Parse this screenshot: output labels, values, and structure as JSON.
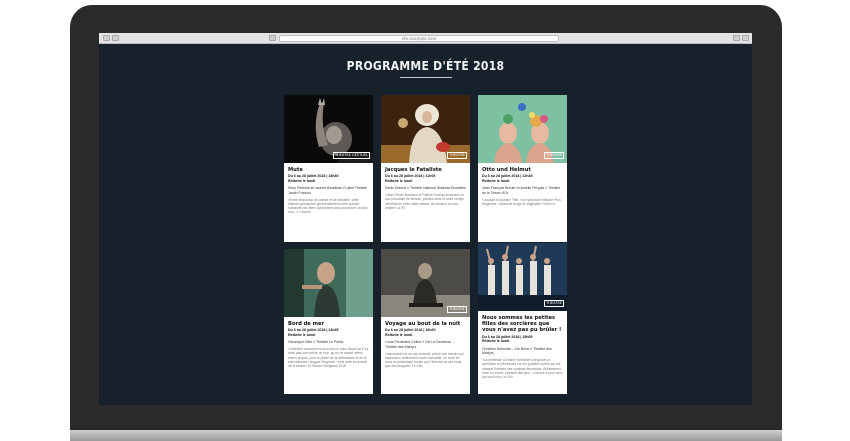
{
  "browser": {
    "url": "ete.example.com"
  },
  "page": {
    "title": "PROGRAMME D'ÉTÉ 2018"
  },
  "cards": [
    {
      "title": "Mute",
      "date": "Du 6 au 28 juillet 2018 | 18h40",
      "relache": "Relâche le lundi",
      "credits": "Sony Perlesia et Laurent Baudilias // Label Théâtre Jardin Fossion",
      "description": "«Entre beaucoup de poésie et de fantaisie, cette histoire questionne généreusement notre grande humanité des êtres qui tentent sans prononcer un seul mot...» L'Avenir",
      "tag": "THÉÂTRE GESTUEL"
    },
    {
      "title": "Jacques le Fataliste",
      "date": "Du 6 au 28 juillet 2018 | 11h05",
      "relache": "Relâche le lundi",
      "credits": "Denis Diderot // Théâtre National Wallonie-Bruxelles",
      "description": "«Jean-Pierre Baudson et Patrick Donnay incarnent un duo percutant de finesse, jubilant dans la toute vertige ventriste de cette fable mêlant, de dérision et avec amitié» La RT",
      "tag": "THÉÂTRE"
    },
    {
      "title": "Otto und Helmut",
      "date": "Du 6 au 28 juillet 2018 | 12h45",
      "relache": "Relâche le lundi",
      "credits": "Jean-François Breuer et Aurélie Pergola // Théâtre de la Toison d'Or",
      "description": "«Jouissif à souhait» Télé, «Un spectacle brillant» Plus Magazine, «Absurde burge et originalité» Vivre Ici",
      "tag": "THÉÂTRE"
    },
    {
      "title": "Bord de mer",
      "date": "Du 6 au 28 juillet 2018 | 14h45",
      "relache": "Relâche le lundi",
      "credits": "Véronique Olmi // Théâtre Le Public",
      "description": "«Vraiment comment nous sortis en nous disant qu'il n'y avait pas une mérite de trop, qu'on ne savait même mieux propos, pour le plaisir de la délicatesse et de la bienveillance» Nagyot Prugnauf, «Une tarte excentrée de la beaux» Si Sauvez Bergasse 2018",
      "tag": ""
    },
    {
      "title": "Voyage au bout de la nuit",
      "date": "Du 6 au 28 juillet 2018 | 16h20",
      "relache": "Relâche le lundi",
      "credits": "Louis-Ferdinand Céline // Cie La Semeuse – Théâtre des Martyrs",
      "description": "«Impossible de ne pas ressortir séduit une histoire qui impression amèrement toute l'actualité, ne cède en nous la symbolique toutes que l'éventre sa sec toute que des longues» Le Soir",
      "tag": "THÉÂTRE"
    },
    {
      "title": "Nous sommes les petites filles des sorcières que vous n'avez pas pu brûler !",
      "date": "Du 6 au 28 juillet 2018 | 18h05",
      "relache": "Relâche le lundi",
      "credits": "Christine Delmotte – Cie Biloxi // Théâtre des Martyrs",
      "description": "«La metteuse Christine Delmotte a proposé un spectacle en féministes sur les grandes sortes qui ont marqué l'histoire des combats féministes. Brillamment mise en scène, pétrisée des jeux...L'amour à pour ceux qui sont loin» Le Soir",
      "tag": "THÉÂTRE"
    }
  ]
}
